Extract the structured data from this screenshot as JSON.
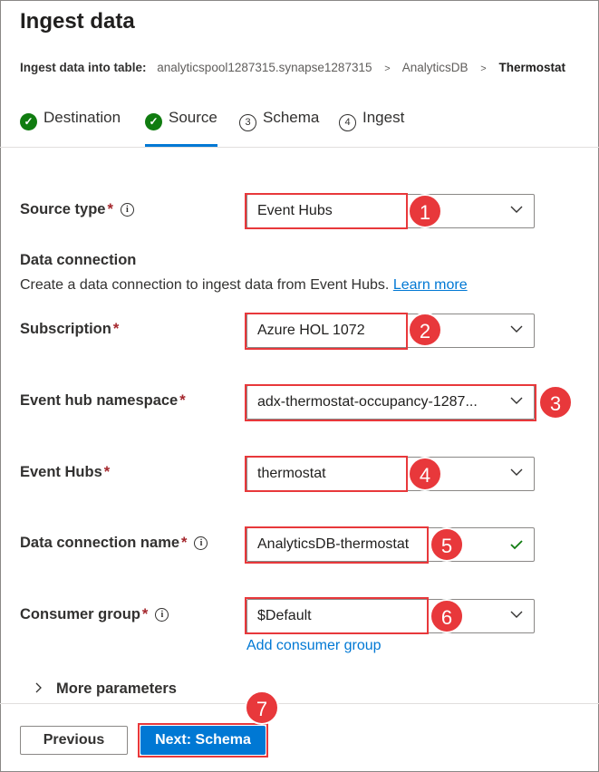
{
  "page": {
    "title": "Ingest data"
  },
  "breadcrumb": {
    "label": "Ingest data into table:",
    "items": [
      "analyticspool1287315.synapse1287315",
      "AnalyticsDB",
      "Thermostat"
    ],
    "separator": ">"
  },
  "tabs": [
    {
      "label": "Destination",
      "state": "done",
      "icon": "check-circle-icon"
    },
    {
      "label": "Source",
      "state": "done-active",
      "icon": "check-circle-icon"
    },
    {
      "label": "Schema",
      "number": "3"
    },
    {
      "label": "Ingest",
      "number": "4"
    }
  ],
  "form": {
    "source_type": {
      "label": "Source type",
      "required": "*",
      "value": "Event Hubs"
    },
    "data_connection": {
      "title": "Data connection",
      "description": "Create a data connection to ingest data from Event Hubs.",
      "learn_more": "Learn more"
    },
    "subscription": {
      "label": "Subscription",
      "required": "*",
      "value": "Azure HOL 1072"
    },
    "namespace": {
      "label": "Event hub namespace",
      "required": "*",
      "value": "adx-thermostat-occupancy-1287..."
    },
    "event_hubs": {
      "label": "Event Hubs",
      "required": "*",
      "value": "thermostat"
    },
    "connection_name": {
      "label": "Data connection name",
      "required": "*",
      "value": "AnalyticsDB-thermostat"
    },
    "consumer_group": {
      "label": "Consumer group",
      "required": "*",
      "value": "$Default"
    },
    "add_consumer_group": "Add consumer group",
    "more_parameters": "More parameters"
  },
  "info_glyph": "i",
  "callouts": [
    "1",
    "2",
    "3",
    "4",
    "5",
    "6",
    "7"
  ],
  "footer": {
    "previous": "Previous",
    "next": "Next: Schema"
  },
  "colors": {
    "accent": "#0078d4",
    "success": "#107c10",
    "callout": "#e8383b",
    "required": "#a4262c"
  }
}
